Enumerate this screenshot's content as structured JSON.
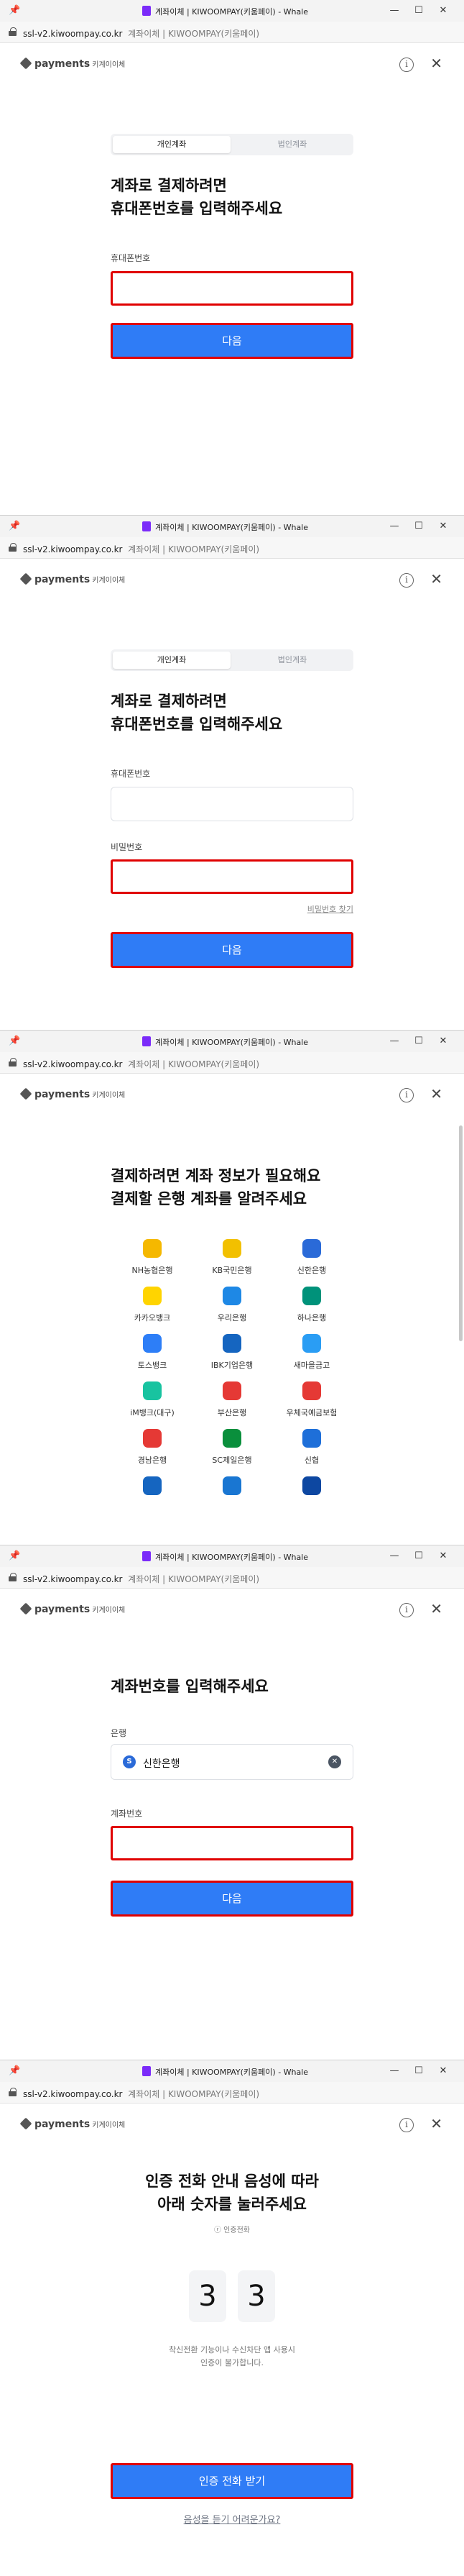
{
  "window": {
    "title": "계좌이체 | KIWOOMPAY(키움페이) - Whale",
    "url_host": "ssl-v2.kiwoompay.co.kr",
    "url_rest": "계좌이체 | KIWOOMPAY(키움페이)",
    "controls": {
      "minimize": "—",
      "maximize": "☐",
      "close": "✕"
    }
  },
  "brand": {
    "name": "payments",
    "sub": "키계이이체"
  },
  "header_icons": {
    "info": "i",
    "close": "✕"
  },
  "tabs": [
    "개인계좌",
    "법인계좌"
  ],
  "screen1": {
    "heading": [
      "계좌로 결제하려면",
      "휴대폰번호를 입력해주세요"
    ],
    "phone_label": "휴대폰번호",
    "next_button": "다음"
  },
  "screen2": {
    "heading": [
      "계좌로 결제하려면",
      "휴대폰번호를 입력해주세요"
    ],
    "phone_label": "휴대폰번호",
    "password_label": "비밀번호",
    "forgot_password": "비밀번호 찾기",
    "next_button": "다음"
  },
  "screen3": {
    "heading": [
      "결제하려면 계좌 정보가 필요해요",
      "결제할 은행 계좌를 알려주세요"
    ],
    "banks": [
      {
        "name": "NH농협은행",
        "color": "#f5b800"
      },
      {
        "name": "KB국민은행",
        "color": "#f2c000"
      },
      {
        "name": "신한은행",
        "color": "#2a6ad8"
      },
      {
        "name": "카카오뱅크",
        "color": "#ffd400"
      },
      {
        "name": "우리은행",
        "color": "#1e88e5"
      },
      {
        "name": "하나은행",
        "color": "#00927a"
      },
      {
        "name": "토스뱅크",
        "color": "#2d7ef7"
      },
      {
        "name": "IBK기업은행",
        "color": "#1565c0"
      },
      {
        "name": "새마을금고",
        "color": "#2a9df4"
      },
      {
        "name": "iM뱅크(대구)",
        "color": "#18c3a0"
      },
      {
        "name": "부산은행",
        "color": "#e53935"
      },
      {
        "name": "우체국예금보험",
        "color": "#e53935"
      },
      {
        "name": "경남은행",
        "color": "#e53935"
      },
      {
        "name": "SC제일은행",
        "color": "#0a8f3c"
      },
      {
        "name": "신협",
        "color": "#1e6fd9"
      }
    ]
  },
  "screen4": {
    "heading": "계좌번호를 입력해주세요",
    "bank_label": "은행",
    "bank_selected": "신한은행",
    "account_label": "계좌번호",
    "next_button": "다음"
  },
  "screen5": {
    "heading": [
      "인증 전화 안내 음성에 따라",
      "아래 숫자를 눌러주세요"
    ],
    "caller": "ⓡ 인증전화",
    "digits": [
      "3",
      "3"
    ],
    "note": [
      "착신전환 기능이나 수신차단 앱 사용시",
      "인증이 불가합니다."
    ],
    "call_button": "인증 전화 받기",
    "help_link": "음성을 듣기 어려운가요?"
  }
}
